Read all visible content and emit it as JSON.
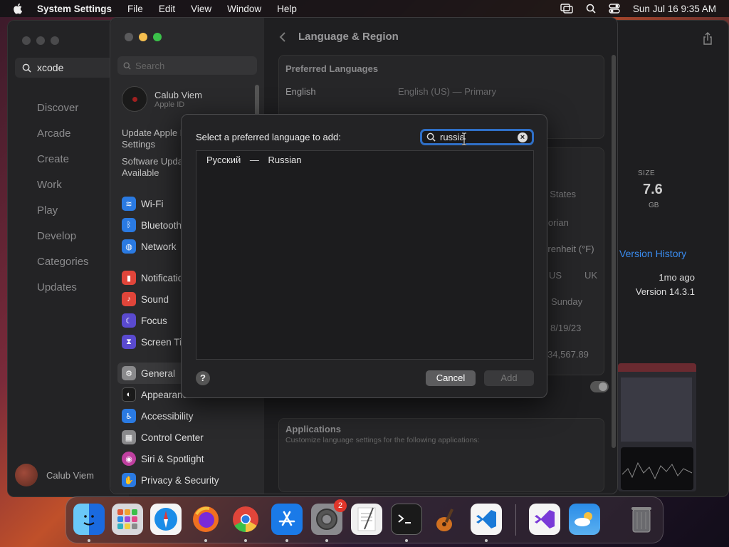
{
  "menubar": {
    "app_name": "System Settings",
    "menus": [
      "File",
      "Edit",
      "View",
      "Window",
      "Help"
    ],
    "clock": "Sun Jul 16  9:35 AM"
  },
  "appstore": {
    "search_value": "xcode",
    "nav": [
      "Discover",
      "Arcade",
      "Create",
      "Work",
      "Play",
      "Develop",
      "Categories",
      "Updates"
    ],
    "user_name": "Calub Viem",
    "size_label": "SIZE",
    "size_value": "7.6",
    "size_unit": "GB",
    "version_history": "Version History",
    "updated_ago": "1mo ago",
    "version": "Version 14.3.1"
  },
  "settings": {
    "search_placeholder": "Search",
    "profile_name": "Calub Viem",
    "profile_sub": "Apple ID",
    "update_line1": "Update Apple ID",
    "update_line2": "Settings",
    "software_line1": "Software Update",
    "software_line2": "Available",
    "sidebar_items": [
      {
        "label": "Wi-Fi",
        "color": "#2a7ae2",
        "glyph": "≋"
      },
      {
        "label": "Bluetooth",
        "color": "#2a7ae2",
        "glyph": "ᛒ"
      },
      {
        "label": "Network",
        "color": "#2a7ae2",
        "glyph": "◍"
      },
      {
        "label": "Notifications",
        "color": "#e0453a",
        "glyph": "▮"
      },
      {
        "label": "Sound",
        "color": "#e0453a",
        "glyph": "♪"
      },
      {
        "label": "Focus",
        "color": "#5a4acf",
        "glyph": "☾"
      },
      {
        "label": "Screen Time",
        "color": "#5a4acf",
        "glyph": "⧗"
      },
      {
        "label": "General",
        "color": "#8a8a8c",
        "glyph": "⚙"
      },
      {
        "label": "Appearance",
        "color": "#1a1a1a",
        "glyph": "◐"
      },
      {
        "label": "Accessibility",
        "color": "#2a7ae2",
        "glyph": "♿"
      },
      {
        "label": "Control Center",
        "color": "#8a8a8c",
        "glyph": "▦"
      },
      {
        "label": "Siri & Spotlight",
        "color": "#c040a0",
        "glyph": "◉"
      },
      {
        "label": "Privacy & Security",
        "color": "#2a7ae2",
        "glyph": "✋"
      }
    ],
    "title": "Language & Region",
    "preferred_languages_heading": "Preferred Languages",
    "language_name": "English",
    "language_detail": "English (US) — Primary",
    "region_value": "United States",
    "calendar_value": "Gregorian",
    "temperature_value": "Fahrenheit (°F)",
    "measurement_us": "US",
    "measurement_uk": "UK",
    "first_day_value": "Sunday",
    "date_format_value": "8/19/23",
    "number_format_value": "1,234,567.89",
    "applications_heading": "Applications",
    "applications_sub": "Customize language settings for the following applications:"
  },
  "dialog": {
    "prompt": "Select a preferred language to add:",
    "search_value": "russia",
    "result_native": "Русский",
    "result_separator": "—",
    "result_english": "Russian",
    "help_label": "?",
    "cancel_label": "Cancel",
    "add_label": "Add"
  },
  "dock": {
    "apps": [
      {
        "name": "Finder",
        "color": "#2a8ce8"
      },
      {
        "name": "Launchpad",
        "color": "#d8d8dc"
      },
      {
        "name": "Safari",
        "color": "#1a8ce8"
      },
      {
        "name": "Firefox",
        "color": "#f07020"
      },
      {
        "name": "Chrome",
        "color": "#f5f5f5"
      },
      {
        "name": "App Store",
        "color": "#1a7ae8"
      },
      {
        "name": "System Settings",
        "color": "#8a8a8e",
        "badge": "2"
      },
      {
        "name": "TextEdit",
        "color": "#f0f0f0"
      },
      {
        "name": "Terminal",
        "color": "#1a1a1a"
      },
      {
        "name": "GarageBand",
        "color": "#3a3a3a"
      },
      {
        "name": "Visual Studio Code",
        "color": "#f5f5f5"
      },
      {
        "name": "Visual Studio",
        "color": "#f5f5f5"
      },
      {
        "name": "Weather",
        "color": "#3a8ce8"
      },
      {
        "name": "Trash",
        "color": "#5a5a5e"
      }
    ]
  }
}
